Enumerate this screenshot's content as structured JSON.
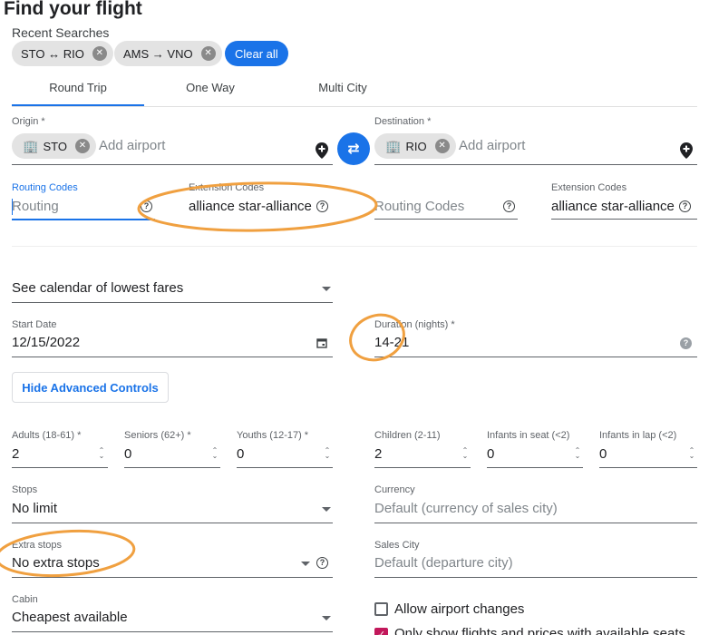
{
  "page": {
    "title": "Find your flight"
  },
  "recent": {
    "label": "Recent Searches",
    "chips": [
      {
        "text": "STO ↔ RIO"
      },
      {
        "text": "AMS → VNO"
      }
    ],
    "clear_label": "Clear all"
  },
  "tabs": [
    {
      "label": "Round Trip",
      "active": true
    },
    {
      "label": "One Way",
      "active": false
    },
    {
      "label": "Multi City",
      "active": false
    }
  ],
  "origin": {
    "label": "Origin *",
    "chip": "STO",
    "placeholder": "Add airport"
  },
  "destination": {
    "label": "Destination *",
    "chip": "RIO",
    "placeholder": "Add airport"
  },
  "left_codes": {
    "routing_label": "Routing Codes",
    "routing_placeholder": "Routing",
    "extension_label": "Extension Codes",
    "extension_value": "alliance star-alliance"
  },
  "right_codes": {
    "routing_placeholder": "Routing Codes",
    "extension_label": "Extension Codes",
    "extension_value": "alliance star-alliance"
  },
  "calendar": {
    "value": "See calendar of lowest fares"
  },
  "start_date": {
    "label": "Start Date",
    "value": "12/15/2022"
  },
  "duration": {
    "label": "Duration (nights) *",
    "value": "14-21"
  },
  "advanced_button": "Hide Advanced Controls",
  "passengers": [
    {
      "label": "Adults (18-61) *",
      "value": "2"
    },
    {
      "label": "Seniors (62+) *",
      "value": "0"
    },
    {
      "label": "Youths (12-17) *",
      "value": "0"
    },
    {
      "label": "Children (2-11)",
      "value": "2"
    },
    {
      "label": "Infants in seat (<2)",
      "value": "0"
    },
    {
      "label": "Infants in lap (<2)",
      "value": "0"
    }
  ],
  "stops": {
    "label": "Stops",
    "value": "No limit"
  },
  "currency": {
    "label": "Currency",
    "placeholder": "Default (currency of sales city)"
  },
  "extra_stops": {
    "label": "Extra stops",
    "value": "No extra stops"
  },
  "sales_city": {
    "label": "Sales City",
    "placeholder": "Default (departure city)"
  },
  "cabin": {
    "label": "Cabin",
    "value": "Cheapest available"
  },
  "options": {
    "allow_airport_changes": {
      "label": "Allow airport changes",
      "checked": false
    },
    "only_available_seats": {
      "label": "Only show flights and prices with available seats",
      "checked": true
    }
  },
  "colors": {
    "accent": "#1a73e8",
    "annotation": "#f0a040",
    "checkbox": "#c2185b"
  }
}
